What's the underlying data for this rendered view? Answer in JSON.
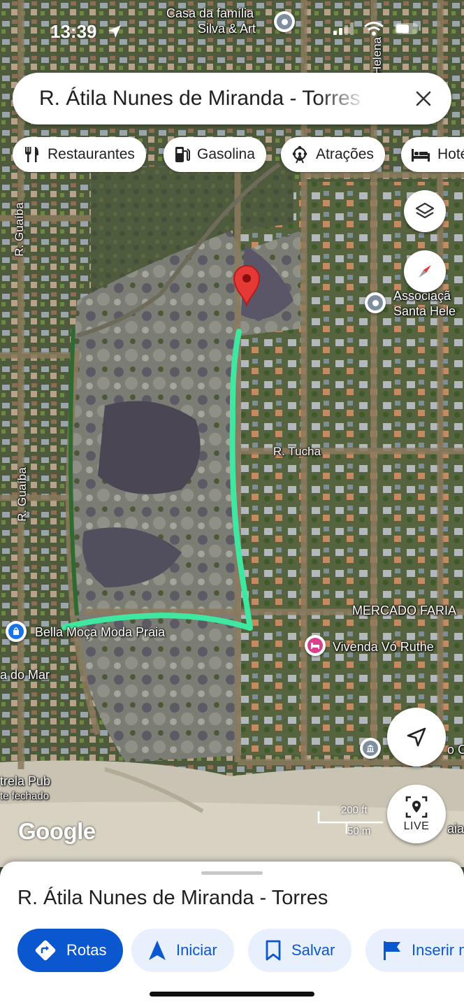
{
  "status_bar": {
    "time": "13:39"
  },
  "search": {
    "query": "R. Átila Nunes de Miranda - Torres"
  },
  "chips": [
    {
      "icon": "fork-knife-icon",
      "label": "Restaurantes"
    },
    {
      "icon": "gas-pump-icon",
      "label": "Gasolina"
    },
    {
      "icon": "ferris-wheel-icon",
      "label": "Atrações"
    },
    {
      "icon": "bed-icon",
      "label": "Hotéis"
    }
  ],
  "map": {
    "streets": {
      "guaiba_top": "R. Guaíba",
      "guaiba_bottom": "R. Guaíba",
      "tucha": "R. Tucha",
      "helena": "Helena"
    },
    "places": {
      "casa_line1": "Casa da família",
      "casa_line2": "Silva & Art",
      "associacao_line1": "Associaçã",
      "associacao_line2": "Santa Hele",
      "mercado": "MERCADO FARIA",
      "bella": "Bella Moça Moda Praia",
      "vivenda": "Vivenda Vó Ruthe",
      "mar": "a do Mar",
      "estrela_line1": "trela Pub",
      "estrela_line2": "te fechado",
      "right_c": "o C",
      "right_praia": "aia"
    },
    "scale": {
      "feet": "200 ft",
      "meters": "50 m"
    },
    "live_label": "LIVE",
    "brand": "Google"
  },
  "colors": {
    "route": "#3ee8a0",
    "pin": "#e53935",
    "primary": "#0b57d0",
    "chip_bg": "#ffffff"
  },
  "sheet": {
    "title": "R. Átila Nunes de Miranda - Torres",
    "actions": [
      {
        "icon": "directions-icon",
        "label": "Rotas",
        "primary": true
      },
      {
        "icon": "navigation-arrow-icon",
        "label": "Iniciar",
        "primary": false
      },
      {
        "icon": "bookmark-icon",
        "label": "Salvar",
        "primary": false
      },
      {
        "icon": "flag-icon",
        "label": "Inserir marcador",
        "primary": false
      }
    ]
  }
}
